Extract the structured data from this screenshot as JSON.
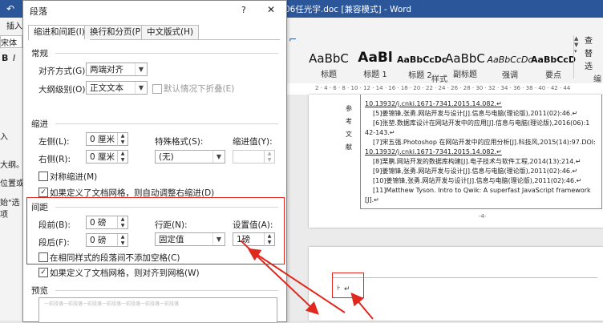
{
  "word": {
    "title": "06任光宇.doc [兼容模式] - Word",
    "left_strip": [
      "插入",
      "宋体",
      "B",
      "I",
      "入",
      "大纲。",
      "位置或",
      "始\"选项"
    ],
    "styles": [
      {
        "sample": "AaBbC",
        "name": "标题"
      },
      {
        "sample": "AaBl",
        "name": "标题 1"
      },
      {
        "sample": "AaBbCcDc",
        "name": "标题 2"
      },
      {
        "sample": "AaBbC",
        "name": "副标题"
      },
      {
        "sample": "AaBbCcDc",
        "name": "强调"
      },
      {
        "sample": "AaBbCcD",
        "name": "要点"
      }
    ],
    "styles_group_label": "样式",
    "edit_group_label": "编",
    "right_ribbon_items": [
      "查",
      "替",
      "选"
    ],
    "ruler_text": "2 · 4 · 6 · 8 · 10 · 12 · 14 · 16 · 18 · 20 · 22 · 24 · 26 · 28 · 30 · 32 · 34 · 36 · 38 · 40 · 42 · 44",
    "side_chars": [
      "参",
      "考",
      "文",
      "献"
    ],
    "references": [
      "10.13932/j.cnki.1671-7341.2015.14.082.↵",
      "[5]姜锦锋,张勇.网站开发与设计[J].信息与电脑(理论版),2011(02):46.↵",
      "[6]张堃.数据库设计在网站开发中的应用[J].信息与电脑(理论版),2016(06):1",
      "42-143.↵",
      "[7]宋五强.Photoshop 在网站开发中的应用分析[J].科技风,2015(14):97.DOI:",
      "10.13932/j.cnki.1671-7341.2015.14.082.↵",
      "[8]栗鹏.网站开发的数据库构建[J].电子技术与软件工程,2014(13):214.↵",
      "[9]姜锦锋,张勇.网站开发与设计[J].信息与电脑(理论版),2011(02):46.↵",
      "[10]姜锦锋,张勇.网站开发与设计[J].信息与电脑(理论版),2011(02):46.↵",
      "[11]Matthew Tyson. Intro to Qwik: A superfast JavaScript framework",
      "[J].↵"
    ],
    "page_number": "-4-"
  },
  "dialog": {
    "title": "段落",
    "help": "?",
    "close": "✕",
    "tabs": [
      "缩进和间距(I)",
      "换行和分页(P)",
      "中文版式(H)"
    ],
    "general": {
      "section": "常规",
      "align_label": "对齐方式(G):",
      "align_value": "两端对齐",
      "outline_label": "大纲级别(O):",
      "outline_value": "正文文本",
      "collapse_label": "默认情况下折叠(E)"
    },
    "indent": {
      "section": "缩进",
      "left_label": "左侧(L):",
      "left_value": "0 厘米",
      "right_label": "右侧(R):",
      "right_value": "0 厘米",
      "special_label": "特殊格式(S):",
      "special_value": "(无)",
      "by_label": "缩进值(Y):",
      "mirror_label": "对称缩进(M)",
      "auto_label": "如果定义了文档网格，则自动调整右缩进(D)"
    },
    "spacing": {
      "section": "间距",
      "before_label": "段前(B):",
      "before_value": "0 磅",
      "after_label": "段后(F):",
      "after_value": "0 磅",
      "line_label": "行距(N):",
      "line_value": "固定值",
      "at_label": "设置值(A):",
      "at_value": "1磅",
      "no_space_label": "在相同样式的段落间不添加空格(C)",
      "grid_label": "如果定义了文档网格，则对齐到网格(W)"
    },
    "preview": {
      "section": "预览",
      "filler": "一前段落一前段落一前段落一前段落一前段落一前段落一前段落"
    }
  }
}
